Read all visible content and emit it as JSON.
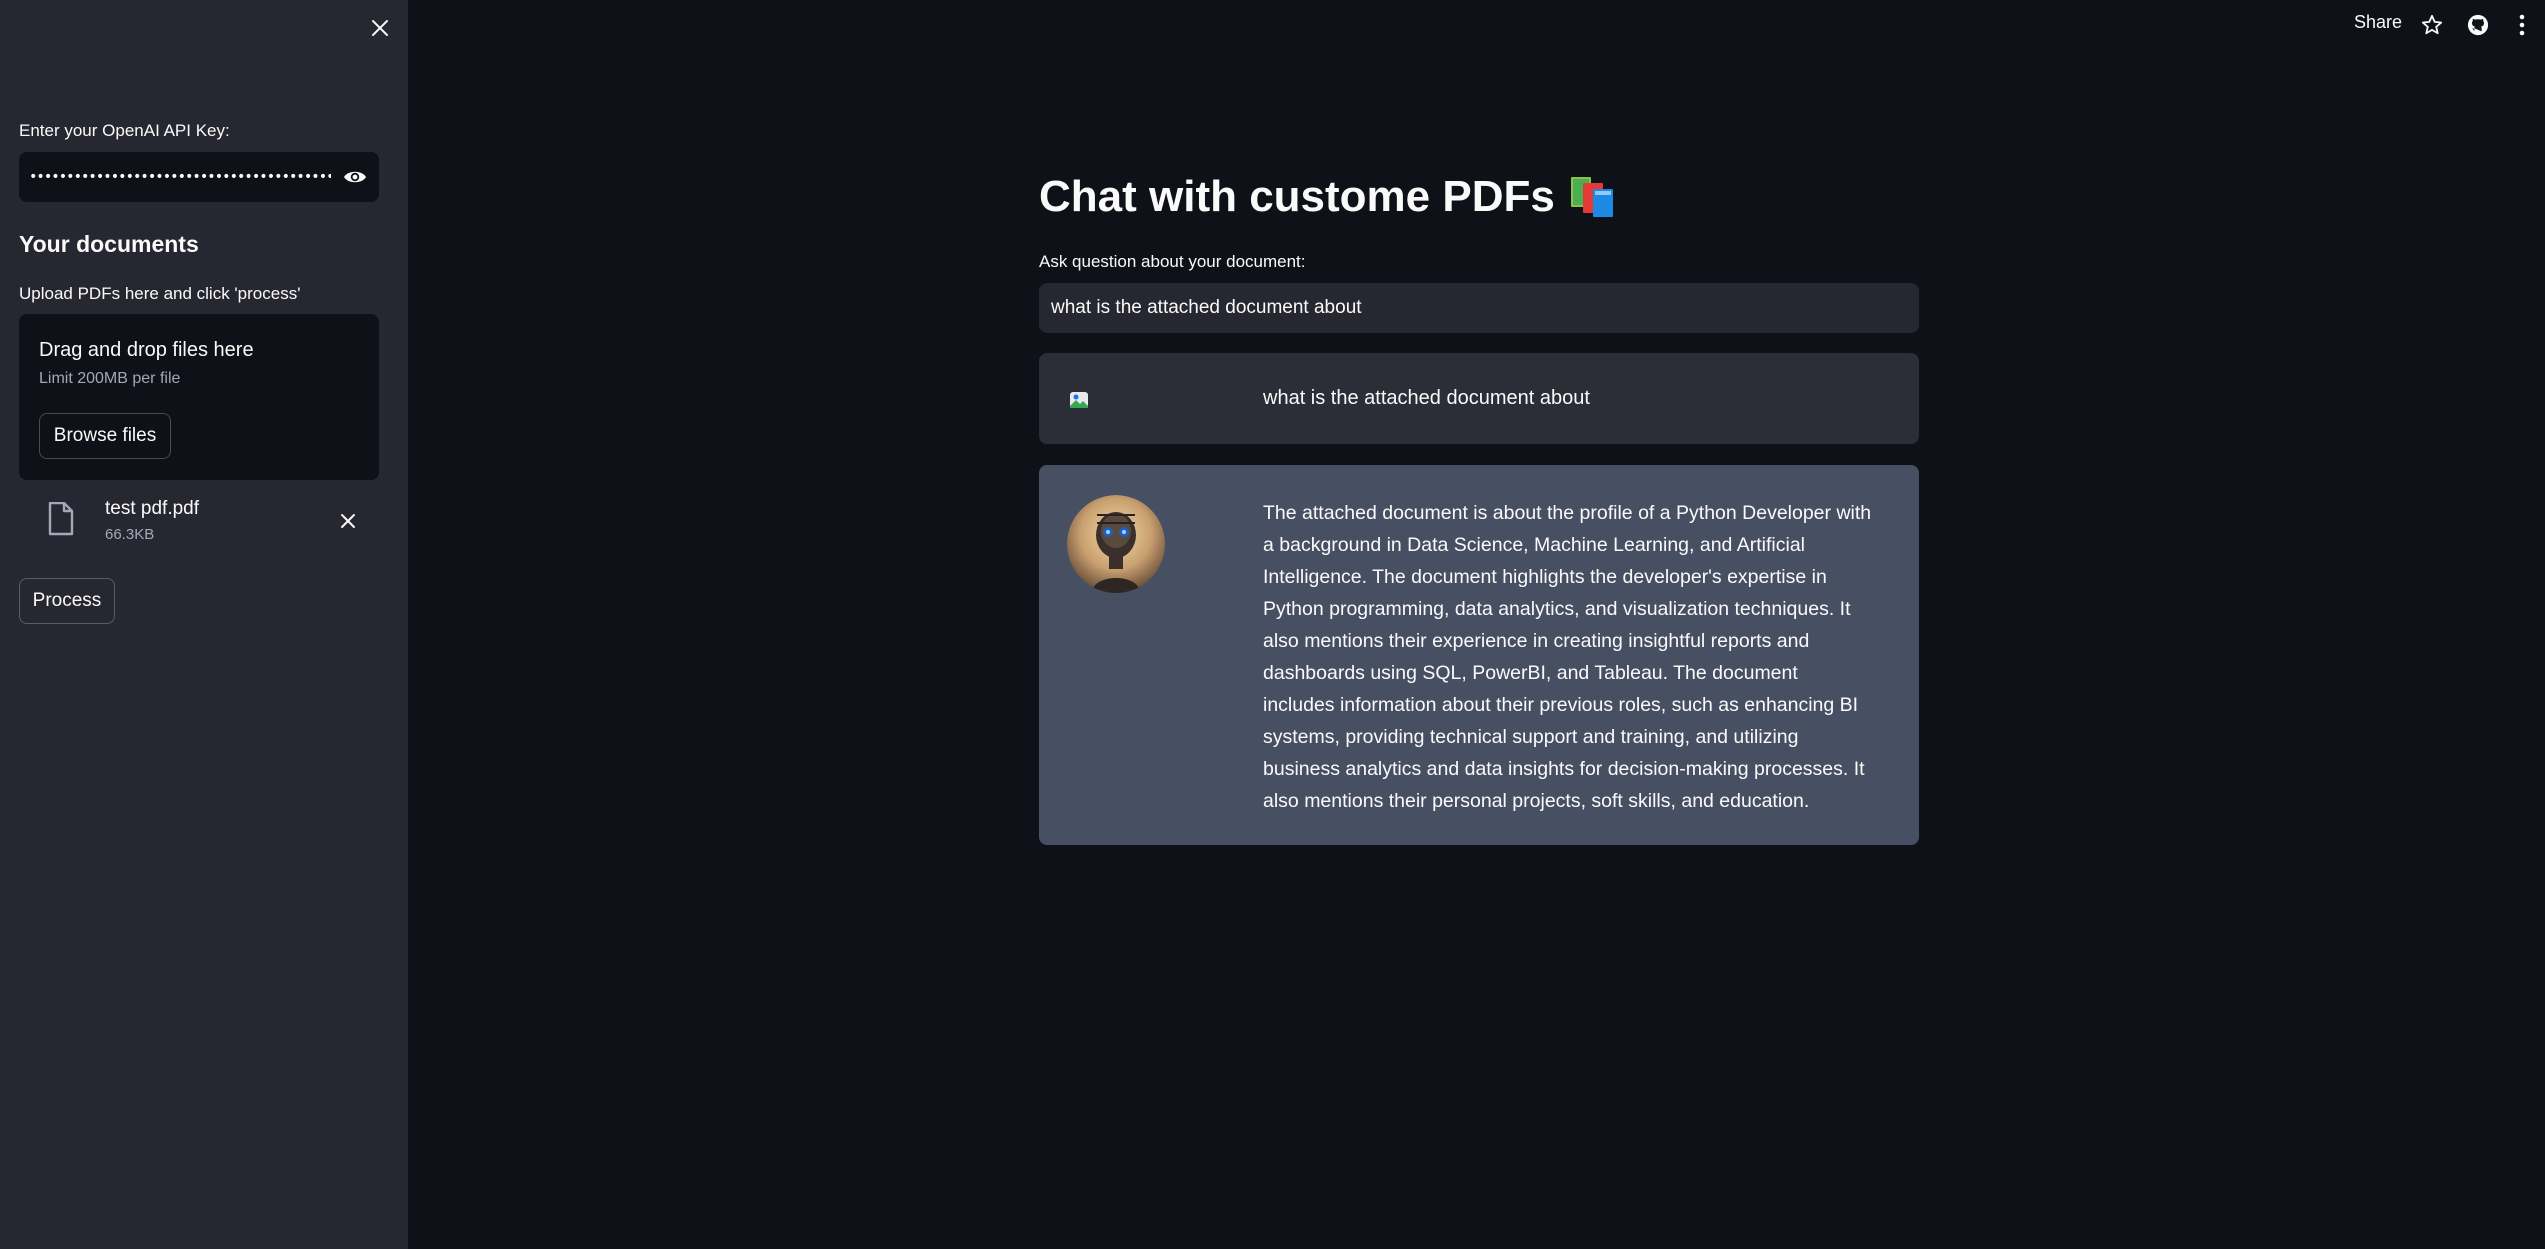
{
  "sidebar": {
    "api_key_label": "Enter your OpenAI API Key:",
    "api_key_value": "•••••••••••••••••••••••••••••••••••••••••••••••••••",
    "documents_heading": "Your documents",
    "upload_instruction": "Upload PDFs here and click 'process'",
    "dropzone": {
      "title": "Drag and drop files here",
      "limit": "Limit 200MB per file",
      "browse_label": "Browse files"
    },
    "file": {
      "name": "test pdf.pdf",
      "size": "66.3KB"
    },
    "process_label": "Process"
  },
  "toolbar": {
    "share_label": "Share",
    "icons": [
      "star-icon",
      "github-icon",
      "more-vertical-icon"
    ]
  },
  "main": {
    "title": "Chat with custome PDFs",
    "title_emoji": "📚",
    "question_label": "Ask question about your document:",
    "question_value": "what is the attached document about"
  },
  "chat": {
    "user_message": "what is the attached document about",
    "bot_message": "The attached document is about the profile of a Python Developer with a background in Data Science, Machine Learning, and Artificial Intelligence. The document highlights the developer's expertise in Python programming, data analytics, and visualization techniques. It also mentions their experience in creating insightful reports and dashboards using SQL, PowerBI, and Tableau. The document includes information about their previous roles, such as enhancing BI systems, providing technical support and training, and utilizing business analytics and data insights for decision-making processes. It also mentions their personal projects, soft skills, and education."
  },
  "colors": {
    "background": "#0e1117",
    "sidebar": "#262730",
    "user_bubble": "#2b2d37",
    "bot_bubble": "#475063"
  }
}
